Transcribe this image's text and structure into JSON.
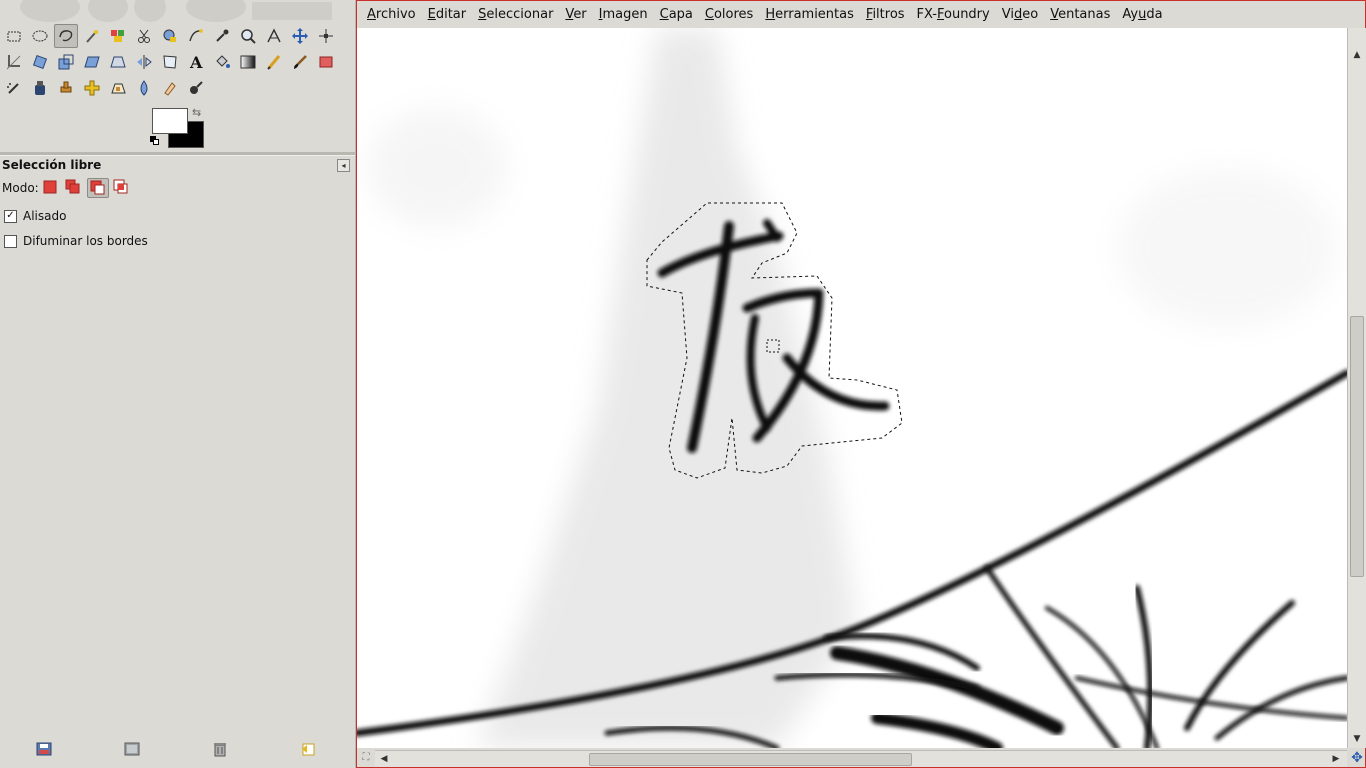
{
  "toolbox": {
    "tools": [
      {
        "name": "rect-select-icon"
      },
      {
        "name": "ellipse-select-icon"
      },
      {
        "name": "free-select-icon",
        "active": true
      },
      {
        "name": "fuzzy-select-icon"
      },
      {
        "name": "select-by-color-icon"
      },
      {
        "name": "scissors-select-icon"
      },
      {
        "name": "foreground-select-icon"
      },
      {
        "name": "paths-icon"
      },
      {
        "name": "color-picker-icon"
      },
      {
        "name": "zoom-icon"
      },
      {
        "name": "measure-icon"
      },
      {
        "name": "move-icon"
      },
      {
        "name": "align-icon"
      },
      {
        "name": "crop-icon"
      },
      {
        "name": "rotate-icon"
      },
      {
        "name": "scale-icon"
      },
      {
        "name": "shear-icon"
      },
      {
        "name": "perspective-icon"
      },
      {
        "name": "flip-icon"
      },
      {
        "name": "cage-icon"
      },
      {
        "name": "text-icon"
      },
      {
        "name": "bucket-fill-icon"
      },
      {
        "name": "blend-icon"
      },
      {
        "name": "pencil-icon"
      },
      {
        "name": "paintbrush-icon"
      },
      {
        "name": "eraser-icon"
      },
      {
        "name": "airbrush-icon"
      },
      {
        "name": "ink-icon"
      },
      {
        "name": "clone-icon"
      },
      {
        "name": "heal-icon"
      },
      {
        "name": "perspective-clone-icon"
      },
      {
        "name": "blur-icon"
      },
      {
        "name": "smudge-icon"
      },
      {
        "name": "dodge-burn-icon"
      }
    ],
    "colors": {
      "foreground": "#ffffff",
      "background": "#000000"
    },
    "options": {
      "title": "Selección libre",
      "mode_label": "Modo:",
      "antialias_label": "Alisado",
      "antialias_checked": true,
      "feather_label": "Difuminar los bordes",
      "feather_checked": false
    }
  },
  "menubar": {
    "items": [
      {
        "pre": "",
        "mn": "A",
        "post": "rchivo"
      },
      {
        "pre": "",
        "mn": "E",
        "post": "ditar"
      },
      {
        "pre": "",
        "mn": "S",
        "post": "eleccionar"
      },
      {
        "pre": "",
        "mn": "V",
        "post": "er"
      },
      {
        "pre": "",
        "mn": "I",
        "post": "magen"
      },
      {
        "pre": "",
        "mn": "C",
        "post": "apa"
      },
      {
        "pre": "",
        "mn": "C",
        "post": "olores"
      },
      {
        "pre": "",
        "mn": "H",
        "post": "erramientas"
      },
      {
        "pre": "",
        "mn": "F",
        "post": "iltros"
      },
      {
        "pre": "FX-",
        "mn": "F",
        "post": "oundry"
      },
      {
        "pre": "Vi",
        "mn": "d",
        "post": "eo"
      },
      {
        "pre": "",
        "mn": "V",
        "post": "entanas"
      },
      {
        "pre": "Ay",
        "mn": "u",
        "post": "da"
      }
    ]
  },
  "accent": {
    "window_border": "#c9302c"
  }
}
